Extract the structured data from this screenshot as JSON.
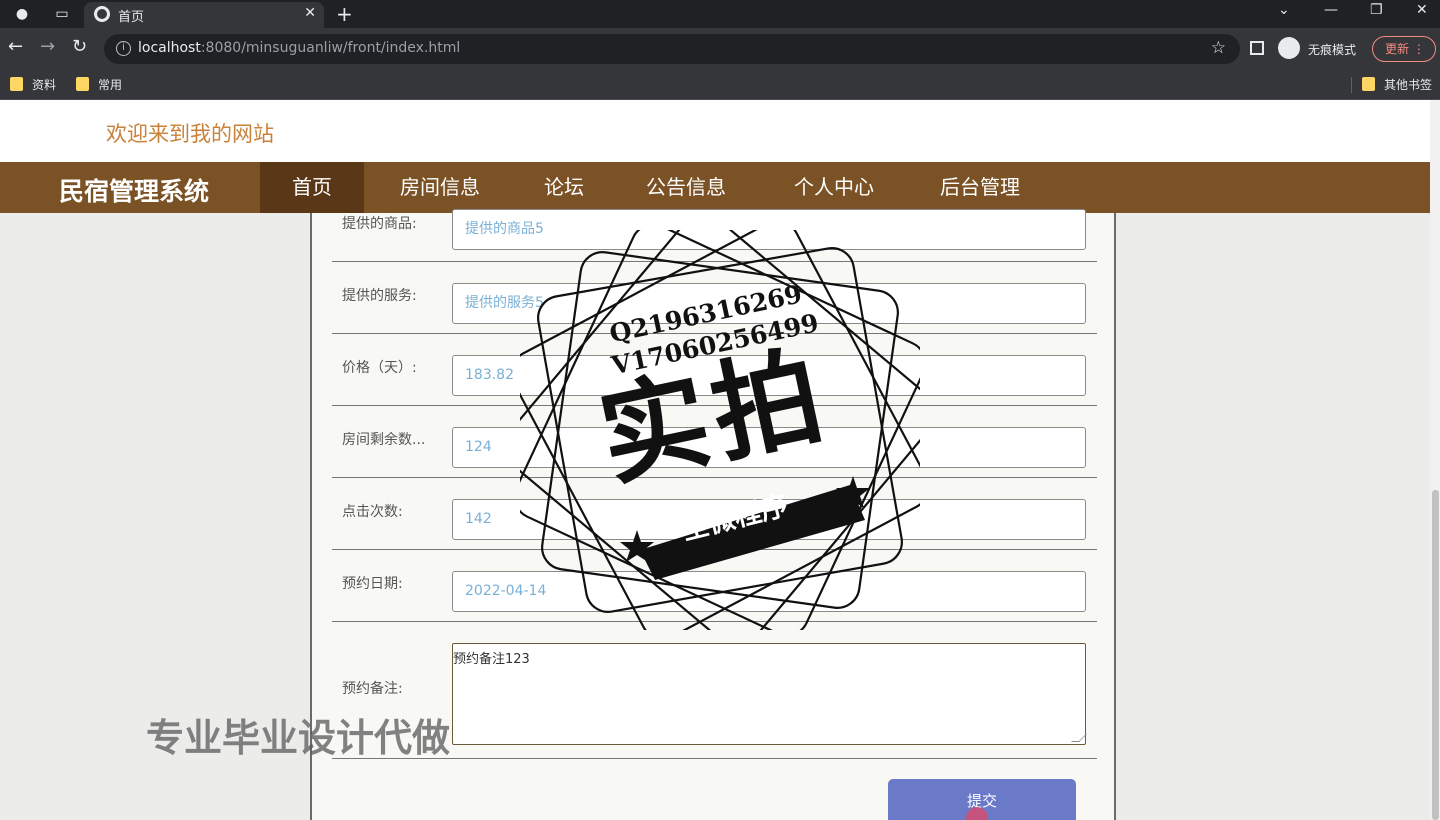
{
  "browser": {
    "tab_title": "首页",
    "url_host": "localhost",
    "url_rest": ":8080/minsuguanliw/front/index.html",
    "incognito_label": "无痕模式",
    "update_label": "更新",
    "bookmarks": [
      "资料",
      "常用"
    ],
    "other_bookmarks": "其他书签"
  },
  "site": {
    "welcome": "欢迎来到我的网站",
    "brand": "民宿管理系统",
    "nav": [
      "首页",
      "房间信息",
      "论坛",
      "公告信息",
      "个人中心",
      "后台管理"
    ],
    "active_nav": "首页"
  },
  "form": {
    "goods_label": "提供的商品:",
    "goods_value": "提供的商品5",
    "service_label": "提供的服务:",
    "service_value": "提供的服务5",
    "price_label": "价格（天）:",
    "price_value": "183.82",
    "rooms_label": "房间剩余数...",
    "rooms_value": "124",
    "clicks_label": "点击次数:",
    "clicks_value": "142",
    "date_label": "预约日期:",
    "date_value": "2022-04-14",
    "note_label": "预约备注:",
    "note_value": "预约备注123",
    "submit_label": "提交"
  },
  "overlay": {
    "stamp_q": "Q2196316269",
    "stamp_v": "V17060256499",
    "stamp_main": "实拍",
    "stamp_banner": "全微程序",
    "watermark": "专业毕业设计代做"
  }
}
